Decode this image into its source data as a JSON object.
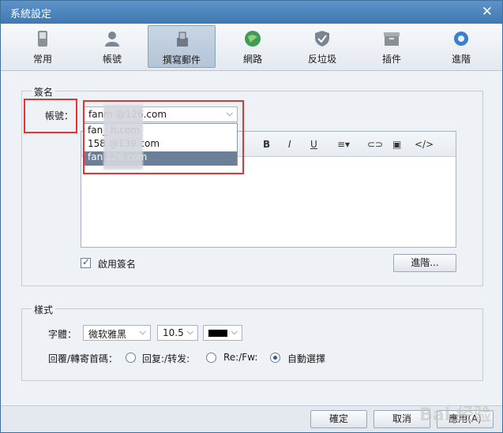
{
  "window": {
    "title": "系統設定",
    "close_glyph": "✕"
  },
  "toolbar": [
    {
      "label": "常用",
      "icon": "phone-icon"
    },
    {
      "label": "帳號",
      "icon": "user-icon"
    },
    {
      "label": "撰寫郵件",
      "icon": "compose-icon"
    },
    {
      "label": "網路",
      "icon": "globe-icon"
    },
    {
      "label": "反垃圾",
      "icon": "shield-icon"
    },
    {
      "label": "插件",
      "icon": "plugin-icon"
    },
    {
      "label": "進階",
      "icon": "gear-icon"
    }
  ],
  "signature": {
    "group_title": "簽名",
    "account_label": "帳號：",
    "account_selected": "fanm @126.com",
    "accounts": [
      "fan_ h.com",
      "158 @139.com",
      "fan 126.com"
    ],
    "editor_tools": [
      "B",
      "I",
      "U",
      "≡▾",
      "⊂⊃",
      "▣",
      "</>"
    ],
    "enable_label": "啟用簽名",
    "advanced_button": "進階..."
  },
  "style": {
    "group_title": "樣式",
    "font_label": "字體：",
    "font_value": "微软雅黑",
    "size_value": "10.5",
    "reply_label": "回覆/轉寄首碼：",
    "options": [
      "回复:/转发:",
      "Re:/Fw:",
      "自動選擇"
    ],
    "selected_option": 2
  },
  "footer": {
    "ok": "確定",
    "cancel": "取消",
    "apply": "應用(A)"
  },
  "watermark": "Bai 经验",
  "colors": {
    "accent": "#3f78b1",
    "highlight": "#e8332e",
    "selection": "#6b7f98"
  }
}
